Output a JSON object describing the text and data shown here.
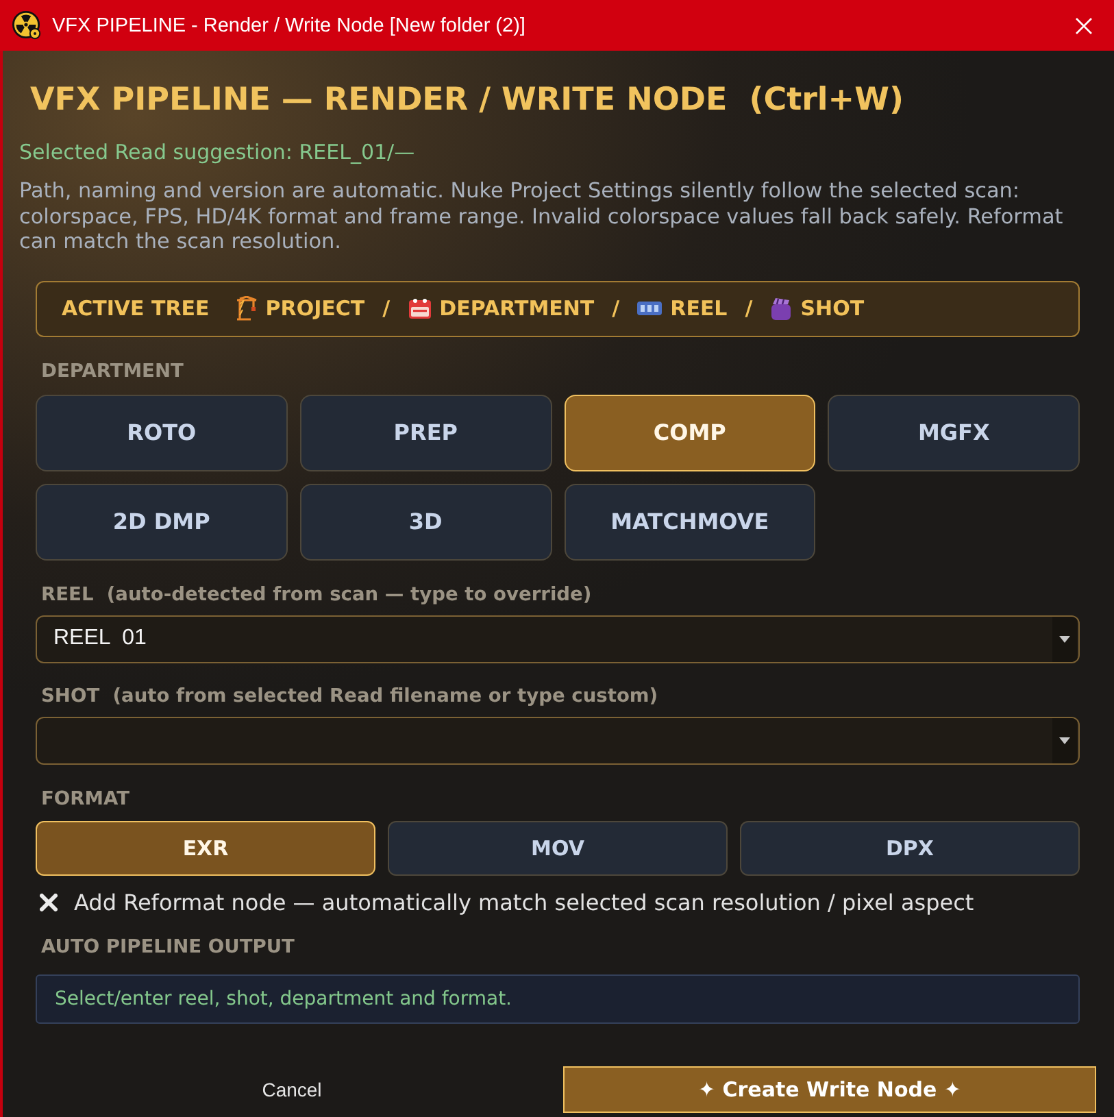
{
  "window": {
    "title": "VFX PIPELINE - Render / Write Node [New folder (2)]"
  },
  "heading": "VFX PIPELINE — RENDER / WRITE NODE  (Ctrl+W)",
  "suggestion": "Selected Read suggestion: REEL_01/—",
  "description": "Path, naming and version are automatic. Nuke Project Settings silently follow the selected scan: colorspace, FPS, HD/4K format and frame range. Invalid colorspace values fall back safely. Reformat can match the scan resolution.",
  "active_tree": {
    "label": "ACTIVE TREE",
    "path": [
      {
        "kind": "project",
        "label": "PROJECT"
      },
      {
        "kind": "department",
        "label": "DEPARTMENT"
      },
      {
        "kind": "reel",
        "label": "REEL"
      },
      {
        "kind": "shot",
        "label": "SHOT"
      }
    ],
    "separators": [
      "/",
      "/",
      "/"
    ]
  },
  "department": {
    "label": "DEPARTMENT",
    "options": [
      {
        "label": "ROTO",
        "selected": false
      },
      {
        "label": "PREP",
        "selected": false
      },
      {
        "label": "COMP",
        "selected": true
      },
      {
        "label": "MGFX",
        "selected": false
      },
      {
        "label": "2D DMP",
        "selected": false
      },
      {
        "label": "3D",
        "selected": false
      },
      {
        "label": "MATCHMOVE",
        "selected": false
      }
    ]
  },
  "reel": {
    "label": "REEL  (auto-detected from scan — type to override)",
    "value": "REEL  01"
  },
  "shot": {
    "label": "SHOT  (auto from selected Read filename or type custom)"
  },
  "format": {
    "label": "FORMAT",
    "options": [
      {
        "label": "EXR",
        "selected": true
      },
      {
        "label": "MOV",
        "selected": false
      },
      {
        "label": "DPX",
        "selected": false
      }
    ]
  },
  "reformat": {
    "checked": true,
    "label": "Add Reformat node — automatically match selected scan resolution / pixel aspect"
  },
  "output": {
    "label": "AUTO PIPELINE OUTPUT",
    "text": "Select/enter reel, shot, department and format."
  },
  "buttons": [
    {
      "kind": "secondary",
      "label": "Cancel"
    },
    {
      "kind": "primary",
      "label": "✦ Create Write Node ✦"
    }
  ]
}
